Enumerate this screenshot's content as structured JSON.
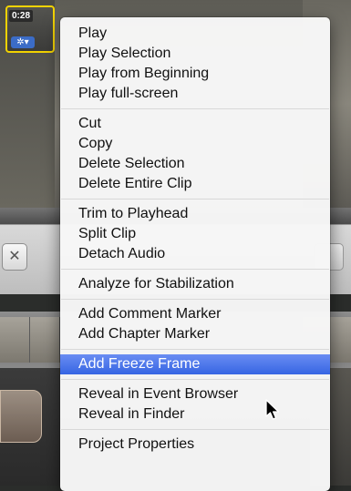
{
  "clip": {
    "duration": "0:28",
    "gear_icon": "gear-icon",
    "gear_glyph": "✲▾"
  },
  "toolbar": {
    "left_button_glyph": "✕"
  },
  "context_menu": {
    "groups": [
      [
        "Play",
        "Play Selection",
        "Play from Beginning",
        "Play full-screen"
      ],
      [
        "Cut",
        "Copy",
        "Delete Selection",
        "Delete Entire Clip"
      ],
      [
        "Trim to Playhead",
        "Split Clip",
        "Detach Audio"
      ],
      [
        "Analyze for Stabilization"
      ],
      [
        "Add Comment Marker",
        "Add Chapter Marker"
      ],
      [
        "Add Freeze Frame"
      ],
      [
        "Reveal in Event Browser",
        "Reveal in Finder"
      ],
      [
        "Project Properties"
      ]
    ],
    "highlighted_item": "Add Freeze Frame",
    "highlight_color": "#3d6ce6"
  }
}
